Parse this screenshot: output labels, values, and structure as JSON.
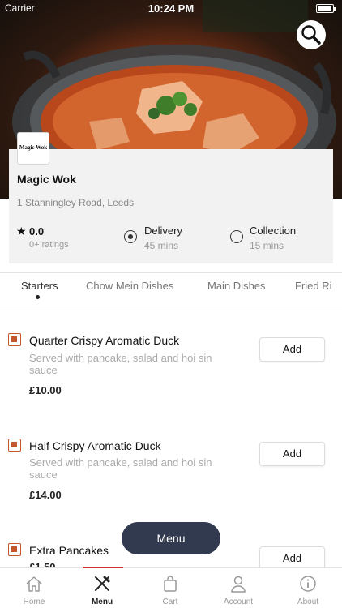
{
  "status_bar": {
    "carrier": "Carrier",
    "time": "10:24 PM"
  },
  "hero": {
    "image": "food-curry-dish",
    "search_icon": "search-icon"
  },
  "restaurant": {
    "logo_text": "Magic Wok",
    "name": "Magic Wok",
    "address": "1 Stanningley Road, Leeds",
    "rating": "0.0",
    "ratings_count": "0+ ratings",
    "delivery_label": "Delivery",
    "delivery_time": "45 mins",
    "collection_label": "Collection",
    "collection_time": "15 mins",
    "selected_option": "Delivery"
  },
  "tabs": [
    "Starters",
    "Chow Mein Dishes",
    "Main Dishes",
    "Fried Ri"
  ],
  "active_tab": "Starters",
  "items": [
    {
      "name": "Quarter Crispy Aromatic Duck",
      "description": "Served with pancake, salad and hoi sin sauce",
      "price": "£10.00",
      "add_label": "Add"
    },
    {
      "name": "Half Crispy Aromatic Duck",
      "description": "Served with pancake, salad and hoi sin sauce",
      "price": "£14.00",
      "add_label": "Add"
    },
    {
      "name": "Extra Pancakes",
      "description": "",
      "price": "£1.50",
      "add_label": "Add"
    }
  ],
  "menu_button": "Menu",
  "bottom_nav": [
    {
      "label": "Home",
      "icon": "home-icon"
    },
    {
      "label": "Menu",
      "icon": "utensils-icon"
    },
    {
      "label": "Cart",
      "icon": "bag-icon"
    },
    {
      "label": "Account",
      "icon": "user-icon"
    },
    {
      "label": "About",
      "icon": "info-icon"
    }
  ],
  "active_nav": "Menu",
  "colors": {
    "accent": "#c4572a",
    "menu_button": "#323a4f",
    "nav_indicator": "#d13030"
  }
}
